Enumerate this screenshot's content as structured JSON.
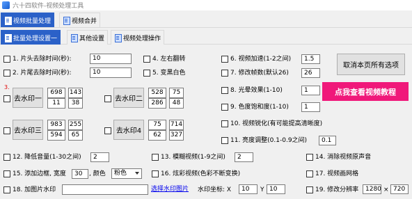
{
  "window": {
    "title": "六十四软件-视频处理工具"
  },
  "main_tabs": [
    "视频批量处理",
    "视频合并"
  ],
  "sub_tabs": [
    "批量处理设置一",
    "其他设置",
    "视频处理操作"
  ],
  "options": {
    "trim_head": {
      "label": "1. 片头去除时间(秒):",
      "value": "10"
    },
    "trim_tail": {
      "label": "2. 片尾去除时间(秒):",
      "value": "10"
    },
    "flip": {
      "label": "4. 左右翻转"
    },
    "bw": {
      "label": "5. 变黑白色"
    },
    "speed": {
      "label": "6. 视频加速(1-2之间)",
      "value": "1.5"
    },
    "fps": {
      "label": "7. 修改帧数(默认26)",
      "value": "26"
    },
    "light": {
      "label": "8. 光晕效果(1-10)",
      "value": "1"
    },
    "saturation": {
      "label": "9. 色度饱和度(1-10)",
      "value": "1"
    },
    "sharpen": {
      "label": "10. 视频锐化(有可能提高清晰度)"
    },
    "brightness": {
      "label": "11. 亮度调整(0.1-0.9之间)",
      "value": "0.1"
    },
    "volume": {
      "label": "12. 降低音量(1-30之间)",
      "value": "2"
    },
    "blur": {
      "label": "13. 模糊视频(1-9之间)",
      "value": "2"
    },
    "mute": {
      "label": "14. 消除视频原声音"
    },
    "border": {
      "label": "15. 添加边框, 宽度",
      "width": "30",
      "color_label": ", 颜色",
      "color": "粉色"
    },
    "colorful": {
      "label": "16. 炫彩视频(色彩不断变换)"
    },
    "grid": {
      "label": "17. 视频画网格"
    },
    "image_watermark": {
      "label": "18. 加图片水印",
      "value": "",
      "choose": "选择水印图片",
      "coord_label": "水印坐标: X",
      "x": "10",
      "y_label": "Y",
      "y": "10"
    },
    "resolution": {
      "label": "19. 修改分辨率",
      "w": "1280",
      "sep": "×",
      "h": "720"
    }
  },
  "watermarks": {
    "marker": "3.",
    "w1": {
      "label": "去水印一",
      "vals": [
        "698",
        "143",
        "11",
        "38"
      ]
    },
    "w2": {
      "label": "去水印二",
      "vals": [
        "528",
        "75",
        "286",
        "48"
      ]
    },
    "w3": {
      "label": "去水印三",
      "vals": [
        "983",
        "255",
        "594",
        "65"
      ]
    },
    "w4": {
      "label": "去水印4",
      "vals": [
        "75",
        "714",
        "62",
        "327"
      ]
    }
  },
  "buttons": {
    "cancel_all": "取消本页所有选项",
    "tutorial": "点我查看视频教程"
  },
  "colors": {
    "tab_active": "#2b61c8",
    "promo": "#f0197a",
    "marker": "#e00000"
  }
}
